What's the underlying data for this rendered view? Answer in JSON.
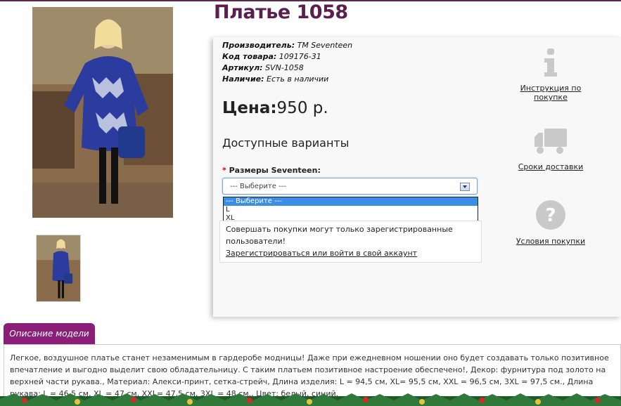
{
  "product": {
    "title": "Платье 1058",
    "specs": [
      {
        "label": "Производитель:",
        "value": "TM Seventeen"
      },
      {
        "label": "Код товара:",
        "value": "109176-31"
      },
      {
        "label": "Артикул:",
        "value": "SVN-1058"
      },
      {
        "label": "Наличие:",
        "value": "Есть в наличии"
      }
    ],
    "price_label": "Цена:",
    "price_value": "950 р.",
    "variants_heading": "Доступные варианты",
    "size_required_mark": "*",
    "size_label": "Размеры Seventeen:",
    "select_value": "--- Выберите ---",
    "options": [
      "--- Выберите ---",
      "L",
      "XL"
    ],
    "notice_text": "Совершать покупки могут только зарегистрированные пользователи!",
    "notice_link": "Зарегистрироваться или войти в свой аккаунт"
  },
  "side": {
    "instructions": "Инструкция по покупке",
    "delivery": "Сроки доставки",
    "conditions": "Условия покупки"
  },
  "tabs": {
    "description_label": "Описание модели"
  },
  "description": "Легкое, воздушное платье станет незаменимым в гардеробе модницы! Даже при ежедневном ношении оно будет создавать только позитивное впечатление и выгодно выделит свою обладательницу. С таким платьем позитивное настроение обеспечено!, Декор: фурнитура под золото на верхней части рукава., Материал: Алекси-принт, сетка-стрейч, Длина изделия: L = 94,5 см, XL= 95,5 см, XXL = 96,5 см, 3XL = 97,5 см., Длина рукава: L = 46,5 см, XL = 47 см, XXL= 47,5 см, 3XL = 48 см., Цвет: белый, синий.",
  "colors": {
    "title": "#5b1f4f",
    "tab": "#8b1f78",
    "select_highlight": "#3a8ee6"
  },
  "icons": [
    "info-icon",
    "truck-icon",
    "question-icon"
  ]
}
